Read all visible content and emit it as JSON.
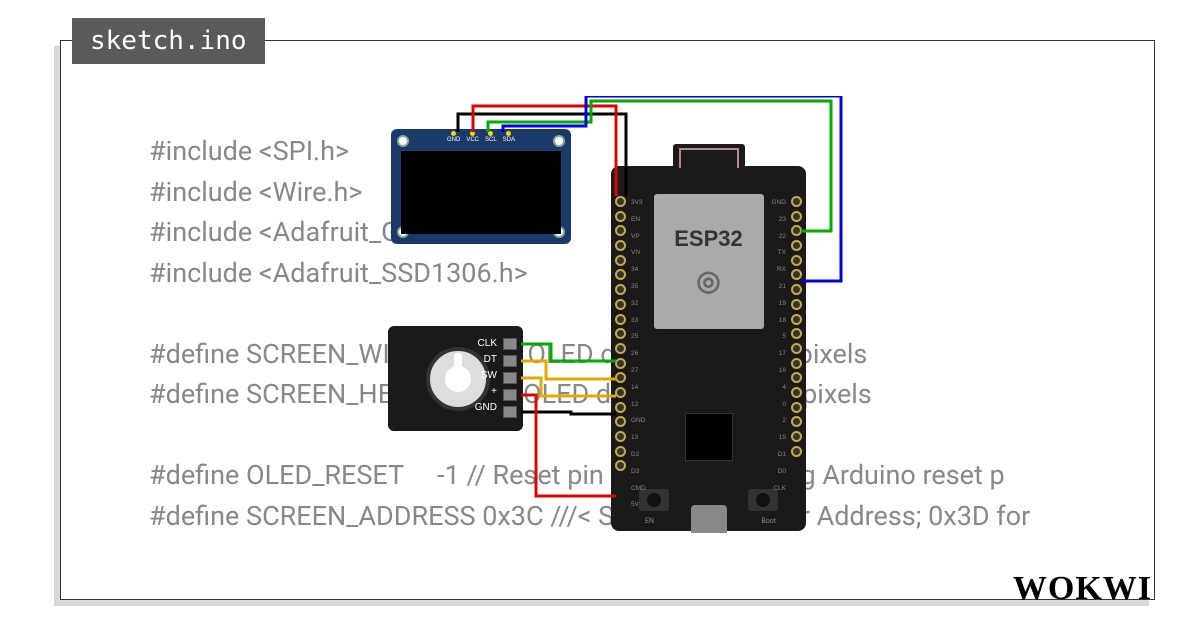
{
  "tab": {
    "filename": "sketch.ino"
  },
  "code": {
    "lines": [
      "#include <SPI.h>",
      "#include <Wire.h>",
      "#include <Adafruit_GFX.h>",
      "#include <Adafruit_SSD1306.h>",
      "",
      "#define SCREEN_WIDTH 128 // OLED display width, in pixels",
      "#define SCREEN_HEIGHT 64 // OLED display height, in pixels",
      "",
      "#define OLED_RESET     -1 // Reset pin # (or -1 if sharing Arduino reset p",
      "#define SCREEN_ADDRESS 0x3C ///< See datasheet for Address; 0x3D for"
    ]
  },
  "oled": {
    "pins": [
      "GND",
      "VCC",
      "SCL",
      "SDA"
    ]
  },
  "encoder": {
    "pins": [
      "CLK",
      "DT",
      "SW",
      "+",
      "GND"
    ]
  },
  "esp32": {
    "label": "ESP32",
    "buttons": {
      "left": "EN",
      "right": "Boot"
    },
    "pins_left": [
      "3V3",
      "EN",
      "VP",
      "VN",
      "34",
      "35",
      "32",
      "33",
      "25",
      "26",
      "27",
      "14",
      "12",
      "GND",
      "13",
      "D2",
      "D3",
      "CMD",
      "5V"
    ],
    "pins_right": [
      "GND",
      "23",
      "22",
      "TX",
      "RX",
      "21",
      "19",
      "18",
      "5",
      "17",
      "16",
      "4",
      "0",
      "2",
      "15",
      "D1",
      "D0",
      "CLK"
    ]
  },
  "brand": "WOKWI",
  "wires": [
    {
      "name": "oled-gnd",
      "color": "#000"
    },
    {
      "name": "oled-vcc",
      "color": "#d00"
    },
    {
      "name": "oled-scl",
      "color": "#0a0"
    },
    {
      "name": "oled-sda",
      "color": "#00d"
    },
    {
      "name": "encoder-clk",
      "color": "#0a0"
    },
    {
      "name": "encoder-dt",
      "color": "#e6a700"
    },
    {
      "name": "encoder-sw",
      "color": "#e6a700"
    },
    {
      "name": "encoder-vcc",
      "color": "#d00"
    },
    {
      "name": "encoder-gnd",
      "color": "#000"
    }
  ]
}
